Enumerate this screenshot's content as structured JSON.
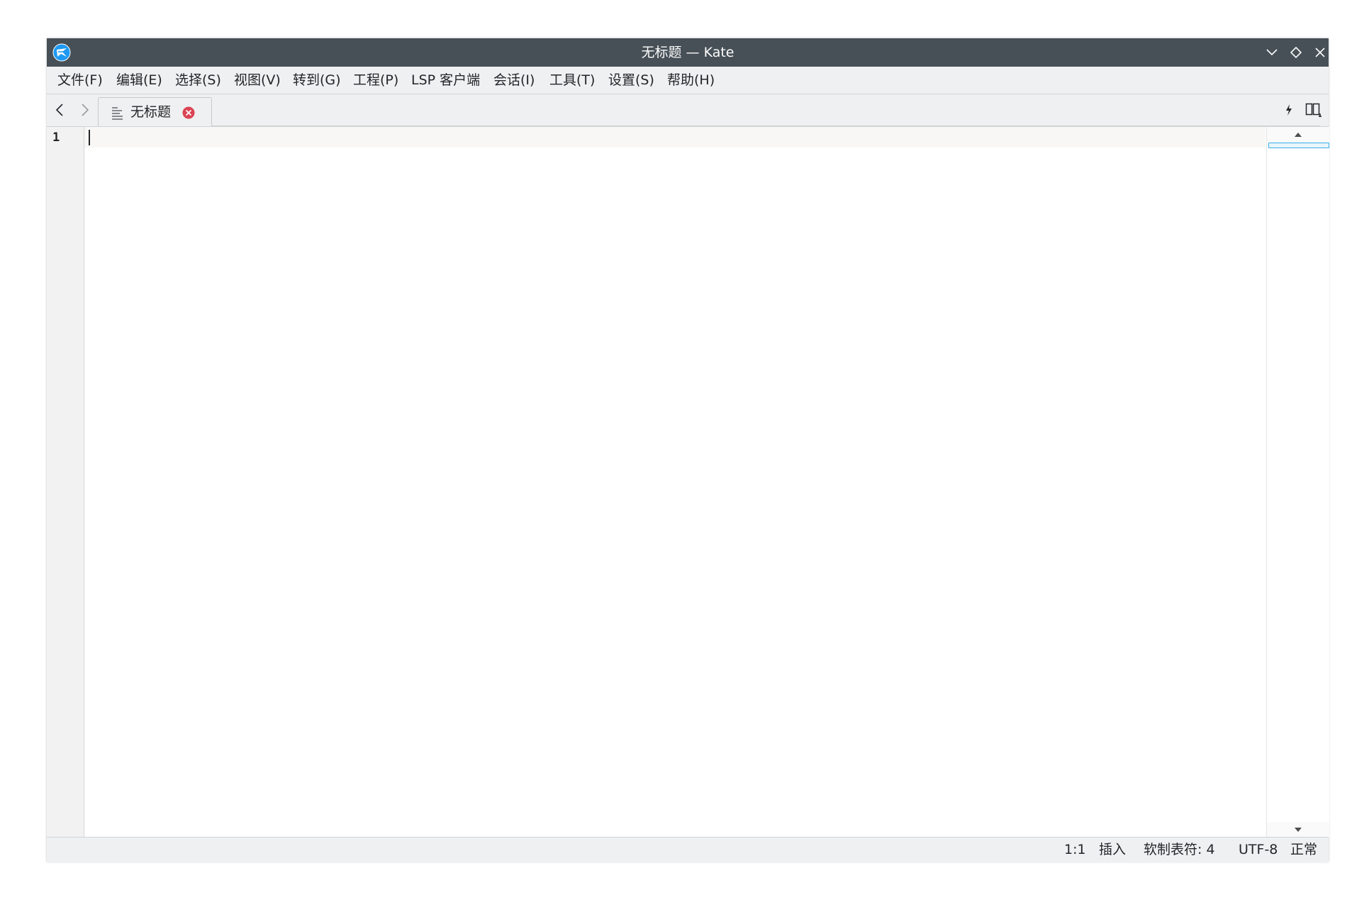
{
  "window": {
    "title": "无标题 — Kate"
  },
  "menubar": {
    "items": [
      {
        "label": "文件(F)"
      },
      {
        "label": "编辑(E)"
      },
      {
        "label": "选择(S)"
      },
      {
        "label": "视图(V)"
      },
      {
        "label": "转到(G)"
      },
      {
        "label": "工程(P)"
      },
      {
        "label": "LSP 客户端"
      },
      {
        "label": "会话(I)"
      },
      {
        "label": "工具(T)"
      },
      {
        "label": "设置(S)"
      },
      {
        "label": "帮助(H)"
      }
    ]
  },
  "tabs": [
    {
      "label": "无标题",
      "active": true
    }
  ],
  "editor": {
    "line_numbers": [
      "1"
    ],
    "content": ""
  },
  "statusbar": {
    "cursor_position": "1:1",
    "input_mode": "插入",
    "indentation": "软制表符: 4",
    "encoding": "UTF-8",
    "mode": "正常"
  },
  "icons": {
    "app": "kate-app-icon",
    "minimize": "chevron-down-icon",
    "maximize": "diamond-icon",
    "close": "close-icon",
    "back": "chevron-left-icon",
    "forward": "chevron-right-icon",
    "document": "text-document-icon",
    "tab_close": "tab-close-icon",
    "quick_open": "lightning-icon",
    "split_view": "split-view-icon"
  },
  "colors": {
    "titlebar": "#475057",
    "accent": "#3daee9",
    "tab_close": "#da4453"
  }
}
